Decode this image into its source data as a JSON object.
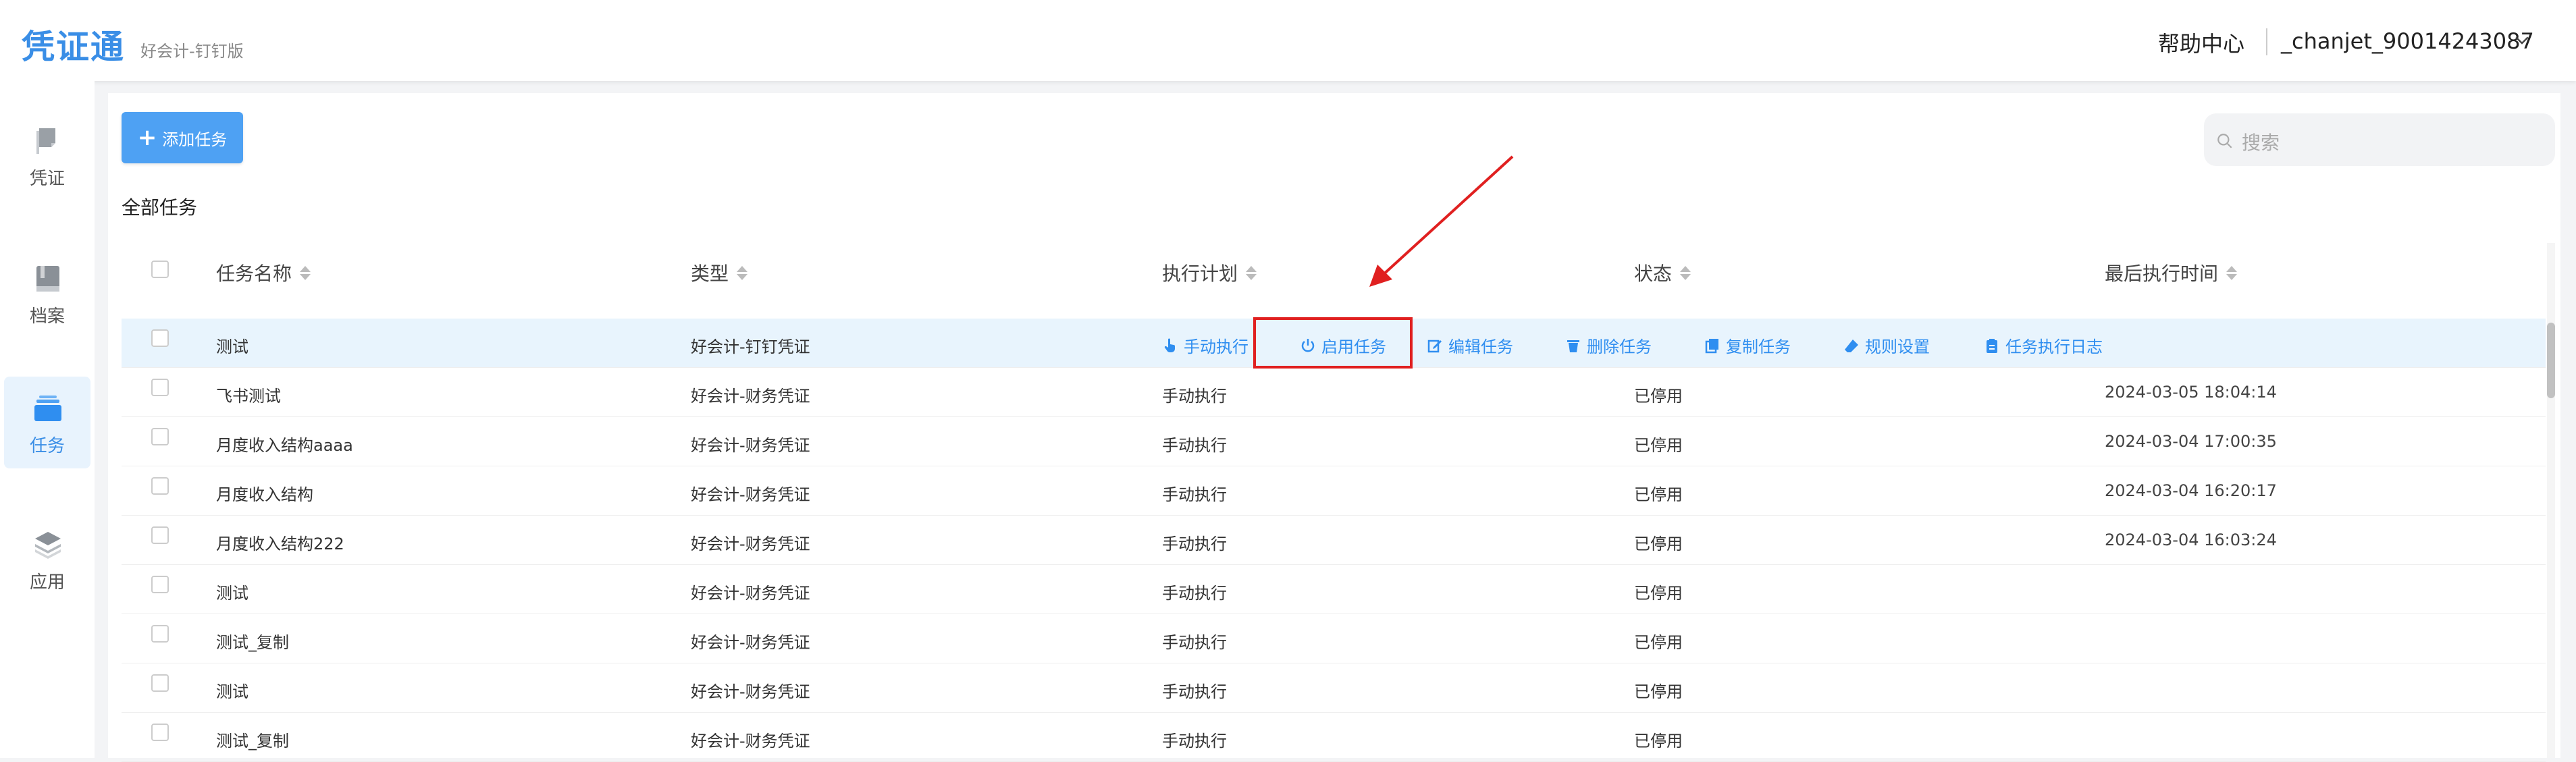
{
  "app": {
    "brand": "凭证通",
    "edition": "好会计-钉钉版",
    "help": "帮助中心",
    "user": "_chanjet_90014243087"
  },
  "sidebar": {
    "items": [
      {
        "label": "凭证",
        "icon": "voucher-icon",
        "active": false
      },
      {
        "label": "档案",
        "icon": "archive-book-icon",
        "active": false
      },
      {
        "label": "任务",
        "icon": "task-stack-icon",
        "active": true
      },
      {
        "label": "应用",
        "icon": "layers-icon",
        "active": false
      }
    ]
  },
  "toolbar": {
    "add_label": "添加任务",
    "search_placeholder": "搜索"
  },
  "section_title": "全部任务",
  "table": {
    "headers": [
      "任务名称",
      "类型",
      "执行计划",
      "状态",
      "最后执行时间"
    ],
    "highlight_row": {
      "name": "测试",
      "type": "好会计-钉钉凭证",
      "actions": [
        {
          "label": "手动执行",
          "icon": "hand-pointer-icon"
        },
        {
          "label": "启用任务",
          "icon": "power-icon"
        },
        {
          "label": "编辑任务",
          "icon": "edit-icon"
        },
        {
          "label": "删除任务",
          "icon": "trash-icon"
        },
        {
          "label": "复制任务",
          "icon": "copy-icon"
        },
        {
          "label": "规则设置",
          "icon": "eraser-icon"
        },
        {
          "label": "任务执行日志",
          "icon": "clipboard-icon"
        }
      ]
    },
    "rows": [
      {
        "name": "飞书测试",
        "type": "好会计-财务凭证",
        "plan": "手动执行",
        "status": "已停用",
        "last": "2024-03-05 18:04:14"
      },
      {
        "name": "月度收入结构aaaa",
        "type": "好会计-财务凭证",
        "plan": "手动执行",
        "status": "已停用",
        "last": "2024-03-04 17:00:35"
      },
      {
        "name": "月度收入结构",
        "type": "好会计-财务凭证",
        "plan": "手动执行",
        "status": "已停用",
        "last": "2024-03-04 16:20:17"
      },
      {
        "name": "月度收入结构222",
        "type": "好会计-财务凭证",
        "plan": "手动执行",
        "status": "已停用",
        "last": "2024-03-04 16:03:24"
      },
      {
        "name": "测试",
        "type": "好会计-财务凭证",
        "plan": "手动执行",
        "status": "已停用",
        "last": ""
      },
      {
        "name": "测试_复制",
        "type": "好会计-财务凭证",
        "plan": "手动执行",
        "status": "已停用",
        "last": ""
      },
      {
        "name": "测试",
        "type": "好会计-财务凭证",
        "plan": "手动执行",
        "status": "已停用",
        "last": ""
      },
      {
        "name": "测试_复制",
        "type": "好会计-财务凭证",
        "plan": "手动执行",
        "status": "已停用",
        "last": ""
      }
    ]
  },
  "colors": {
    "accent": "#3a8ee6",
    "action_link": "#2f8ef0",
    "highlight_row": "#e8f4fd",
    "annotation_red": "#e02020"
  }
}
